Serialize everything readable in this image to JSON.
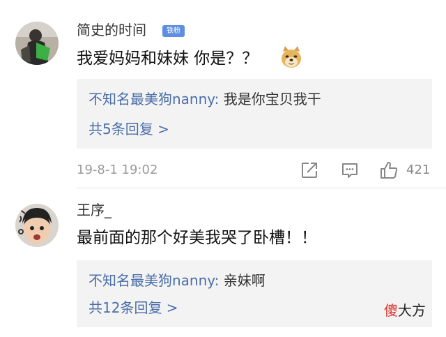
{
  "comments": [
    {
      "username": "简史的时间",
      "badge": "铁粉",
      "text": "我爱妈妈和妹妹 你是？？",
      "emoji": "doge-emoji",
      "reply": {
        "author": "不知名最美狗nanny",
        "separator": ": ",
        "content": "我是你宝贝我干"
      },
      "more_replies": "共5条回复 >",
      "timestamp": "19-8-1 19:02",
      "likes": "421"
    },
    {
      "username": "王序_",
      "text": "最前面的那个好美我哭了卧槽！！",
      "reply": {
        "author": "不知名最美狗nanny",
        "separator": ": ",
        "content": "亲妹啊"
      },
      "more_replies": "共12条回复 >"
    }
  ],
  "watermark": {
    "first_char": "傻",
    "rest": "大方"
  },
  "colors": {
    "link": "#4a6ea8",
    "badge": "#5d8ee0",
    "reply_bg": "#f3f3f3",
    "watermark_accent": "#d8302a"
  }
}
